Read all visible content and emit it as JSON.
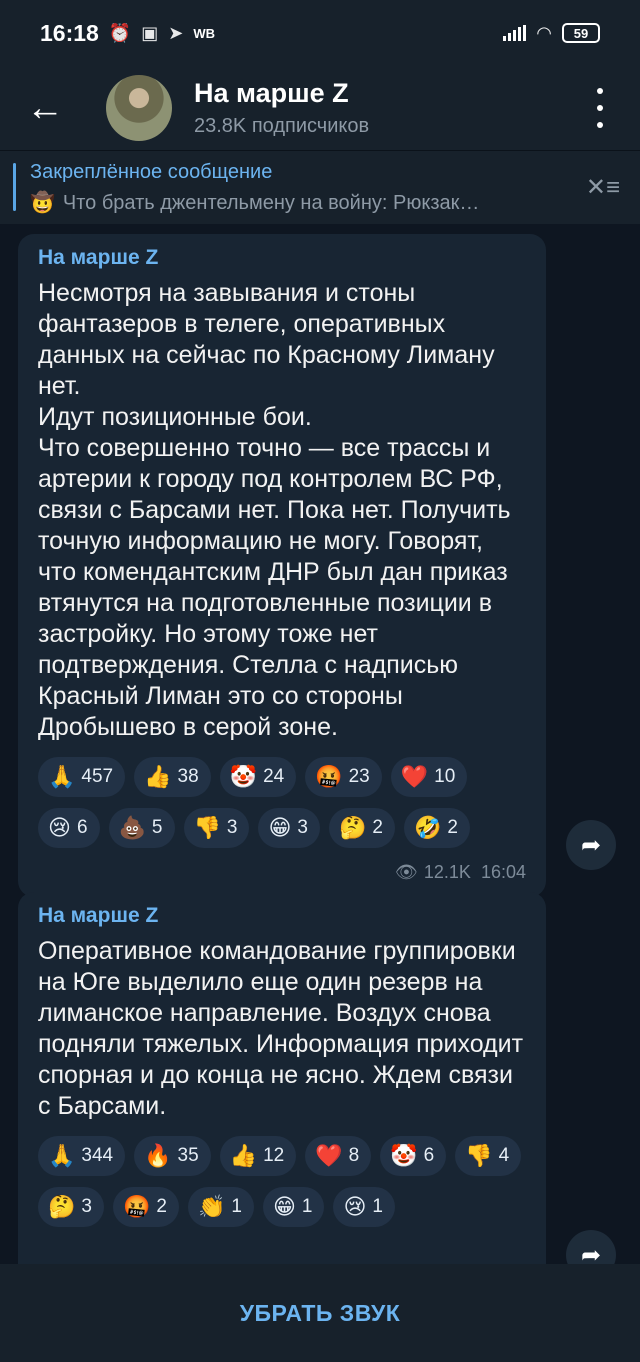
{
  "status": {
    "time": "16:18",
    "icons": [
      "alarm-icon",
      "app-icon",
      "telegram-icon"
    ],
    "carrier_badge": "WB",
    "battery": "59"
  },
  "header": {
    "title": "На марше Z",
    "subtitle": "23.8K подписчиков"
  },
  "pinned": {
    "label": "Закреплённое сообщение",
    "emoji": "🤠",
    "text": "Что брать джентельмену на войну:   Рюкзак…"
  },
  "messages": [
    {
      "author": "На марше Z",
      "text": "Несмотря на завывания и стоны фантазеров в телеге, оперативных данных на сейчас по Красному Лиману нет.\nИдут позиционные бои.\nЧто совершенно точно — все трассы и артерии к городу под контролем ВС РФ, связи с Барсами нет. Пока нет. Получить точную информацию не могу. Говорят, что комендантским ДНР был дан приказ втянутся на подготовленные позиции в застройку. Но этому тоже нет подтверждения. Стелла с надписью Красный Лиман это со стороны Дробышево в серой зоне.",
      "reactions": [
        {
          "emoji": "🙏",
          "count": "457"
        },
        {
          "emoji": "👍",
          "count": "38"
        },
        {
          "emoji": "🤡",
          "count": "24"
        },
        {
          "emoji": "🤬",
          "count": "23"
        },
        {
          "emoji": "❤️",
          "count": "10"
        },
        {
          "emoji": "😢",
          "count": "6"
        },
        {
          "emoji": "💩",
          "count": "5"
        },
        {
          "emoji": "👎",
          "count": "3"
        },
        {
          "emoji": "😁",
          "count": "3"
        },
        {
          "emoji": "🤔",
          "count": "2"
        },
        {
          "emoji": "🤣",
          "count": "2"
        }
      ],
      "views": "12.1K",
      "time": "16:04"
    },
    {
      "author": "На марше Z",
      "text": "Оперативное командование группировки на Юге выделило еще один резерв на лиманское направление. Воздух снова подняли тяжелых. Информация приходит спорная и до конца не ясно. Ждем связи с Барсами.",
      "reactions": [
        {
          "emoji": "🙏",
          "count": "344"
        },
        {
          "emoji": "🔥",
          "count": "35"
        },
        {
          "emoji": "👍",
          "count": "12"
        },
        {
          "emoji": "❤️",
          "count": "8"
        },
        {
          "emoji": "🤡",
          "count": "6"
        },
        {
          "emoji": "👎",
          "count": "4"
        },
        {
          "emoji": "🤔",
          "count": "3"
        },
        {
          "emoji": "🤬",
          "count": "2"
        },
        {
          "emoji": "👏",
          "count": "1"
        },
        {
          "emoji": "😁",
          "count": "1"
        },
        {
          "emoji": "😢",
          "count": "1"
        }
      ]
    }
  ],
  "bottom": {
    "mute_label": "УБРАТЬ ЗВУК"
  }
}
